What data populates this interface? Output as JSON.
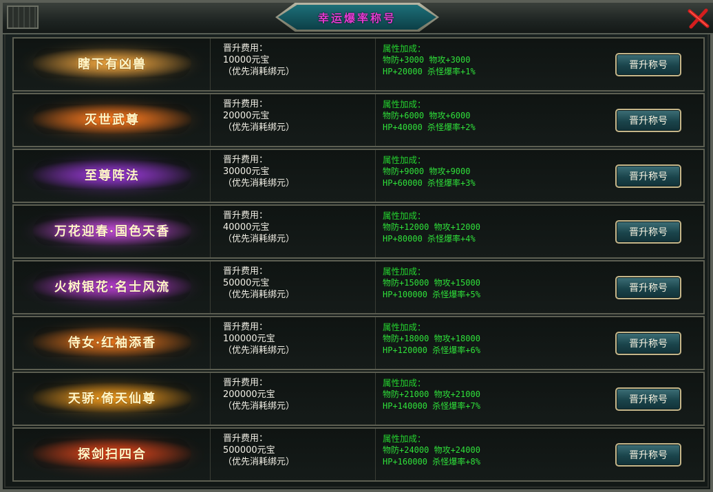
{
  "window": {
    "title": "幸运爆率称号"
  },
  "colors": {
    "title": "#e33bd2",
    "attr_green": "#2fe13a",
    "cost_text": "#f2f0e6",
    "close_red": "#d41e1e"
  },
  "close_icon": "close-x-icon",
  "rows": [
    {
      "badge": "瞎下有凶兽",
      "badge_color": "#f0a640",
      "cost_label": "晋升费用：",
      "cost_value": "10000元宝",
      "cost_note": "（优先消耗绑元）",
      "attr_label": "属性加成：",
      "attr_line1": "物防+3000 物攻+3000",
      "attr_line2": "HP+20000 杀怪爆率+1%",
      "button": "晋升称号"
    },
    {
      "badge": "灭世武尊",
      "badge_color": "#ff7b1f",
      "cost_label": "晋升费用：",
      "cost_value": "20000元宝",
      "cost_note": "（优先消耗绑元）",
      "attr_label": "属性加成：",
      "attr_line1": "物防+6000 物攻+6000",
      "attr_line2": "HP+40000 杀怪爆率+2%",
      "button": "晋升称号"
    },
    {
      "badge": "至尊阵法",
      "badge_color": "#9b3ad9",
      "cost_label": "晋升费用：",
      "cost_value": "30000元宝",
      "cost_note": "（优先消耗绑元）",
      "attr_label": "属性加成：",
      "attr_line1": "物防+9000 物攻+9000",
      "attr_line2": "HP+60000 杀怪爆率+3%",
      "button": "晋升称号"
    },
    {
      "badge": "万花迎春·国色天香",
      "badge_color": "#c04bd6",
      "cost_label": "晋升费用：",
      "cost_value": "40000元宝",
      "cost_note": "（优先消耗绑元）",
      "attr_label": "属性加成：",
      "attr_line1": "物防+12000 物攻+12000",
      "attr_line2": "HP+80000 杀怪爆率+4%",
      "button": "晋升称号"
    },
    {
      "badge": "火树银花·名士风流",
      "badge_color": "#b43fcc",
      "cost_label": "晋升费用：",
      "cost_value": "50000元宝",
      "cost_note": "（优先消耗绑元）",
      "attr_label": "属性加成：",
      "attr_line1": "物防+15000 物攻+15000",
      "attr_line2": "HP+100000 杀怪爆率+5%",
      "button": "晋升称号"
    },
    {
      "badge": "侍女·红袖添香",
      "badge_color": "#e2731d",
      "cost_label": "晋升费用：",
      "cost_value": "100000元宝",
      "cost_note": "（优先消耗绑元）",
      "attr_label": "属性加成：",
      "attr_line1": "物防+18000 物攻+18000",
      "attr_line2": "HP+120000 杀怪爆率+6%",
      "button": "晋升称号"
    },
    {
      "badge": "天骄·倚天仙尊",
      "badge_color": "#f09a1e",
      "cost_label": "晋升费用：",
      "cost_value": "200000元宝",
      "cost_note": "（优先消耗绑元）",
      "attr_label": "属性加成：",
      "attr_line1": "物防+21000 物攻+21000",
      "attr_line2": "HP+140000 杀怪爆率+7%",
      "button": "晋升称号"
    },
    {
      "badge": "探剑扫四合",
      "badge_color": "#e0461c",
      "cost_label": "晋升费用：",
      "cost_value": "500000元宝",
      "cost_note": "（优先消耗绑元）",
      "attr_label": "属性加成：",
      "attr_line1": "物防+24000 物攻+24000",
      "attr_line2": "HP+160000 杀怪爆率+8%",
      "button": "晋升称号"
    }
  ]
}
